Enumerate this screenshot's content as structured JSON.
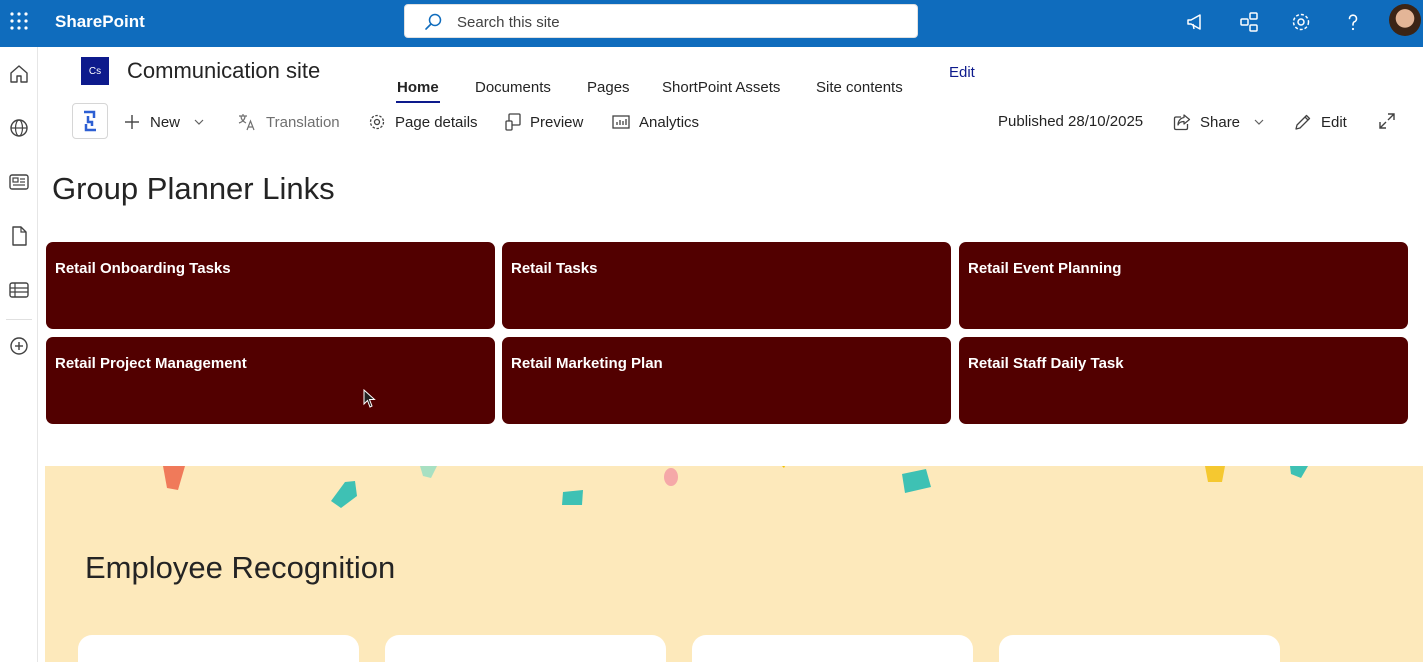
{
  "suite": {
    "brand": "SharePoint",
    "search_placeholder": "Search this site"
  },
  "site": {
    "logo_text": "Cs",
    "title": "Communication site",
    "nav": [
      "Home",
      "Documents",
      "Pages",
      "ShortPoint Assets",
      "Site contents"
    ],
    "nav_edit": "Edit"
  },
  "commandbar": {
    "new_label": "New",
    "translation_label": "Translation",
    "page_details_label": "Page details",
    "preview_label": "Preview",
    "analytics_label": "Analytics",
    "published": "Published 28/10/2025",
    "share_label": "Share",
    "edit_label": "Edit"
  },
  "planner": {
    "title": "Group Planner Links",
    "tile_color": "#520000",
    "links": [
      "Retail Onboarding Tasks",
      "Retail Tasks",
      "Retail Event Planning",
      "Retail Project Management",
      "Retail Marketing Plan",
      "Retail Staff Daily Task"
    ]
  },
  "recognition": {
    "title": "Employee Recognition",
    "background": "#fde9bb"
  },
  "colors": {
    "suite_bar": "#0f6cbd",
    "accent": "#0d1a8c"
  },
  "icons": [
    "app-launcher-icon",
    "search-icon",
    "megaphone-icon",
    "connections-icon",
    "gear-icon",
    "help-icon",
    "home-icon",
    "globe-icon",
    "news-icon",
    "file-icon",
    "list-icon",
    "add-circle-icon"
  ]
}
